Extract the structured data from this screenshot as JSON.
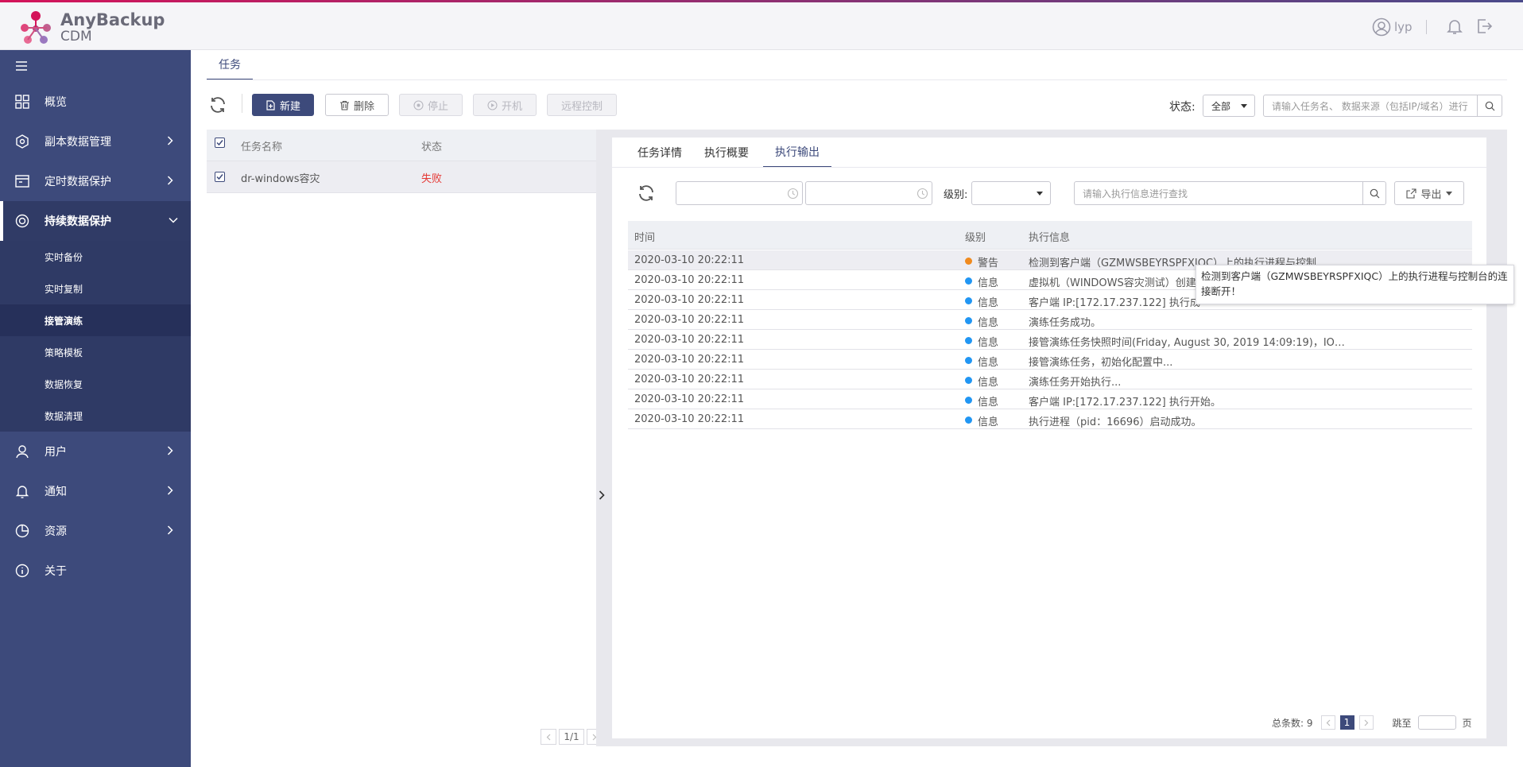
{
  "app": {
    "brand_name": "AnyBackup",
    "brand_sub": "CDM",
    "username": "lyp"
  },
  "colors": {
    "sidebar": "#3d4a7b",
    "accent": "#3d4a7b",
    "warning": "#f08a1e",
    "info": "#2196f3",
    "danger": "#e53935"
  },
  "sidebar": {
    "items": [
      {
        "label": "概览",
        "icon": "dashboard-icon"
      },
      {
        "label": "副本数据管理",
        "icon": "copy-data-icon"
      },
      {
        "label": "定时数据保护",
        "icon": "schedule-protect-icon"
      },
      {
        "label": "持续数据保护",
        "icon": "continuous-protect-icon"
      },
      {
        "label": "用户",
        "icon": "user-icon"
      },
      {
        "label": "通知",
        "icon": "bell-icon"
      },
      {
        "label": "资源",
        "icon": "pie-chart-icon"
      },
      {
        "label": "关于",
        "icon": "info-icon"
      }
    ],
    "subitems": [
      "实时备份",
      "实时复制",
      "接管演练",
      "策略模板",
      "数据恢复",
      "数据清理"
    ]
  },
  "page": {
    "tab": "任务"
  },
  "toolbar": {
    "new": "新建",
    "delete": "删除",
    "stop": "停止",
    "power_on": "开机",
    "remote": "远程控制",
    "status_label": "状态:",
    "status_value": "全部",
    "search_placeholder": "请输入任务名、 数据来源（包括IP/域名）进行"
  },
  "task_list": {
    "col_name": "任务名称",
    "col_status": "状态",
    "rows": [
      {
        "name": "dr-windows容灾",
        "status": "失败"
      }
    ],
    "pager": "1/1"
  },
  "detail": {
    "tabs": [
      "任务详情",
      "执行概要",
      "执行输出"
    ],
    "active_tab": 2,
    "level_label": "级别:",
    "search_placeholder": "请输入执行信息进行查找",
    "export_label": "导出",
    "col_time": "时间",
    "col_level": "级别",
    "col_info": "执行信息",
    "rows": [
      {
        "time": "2020-03-10 20:22:11",
        "level": "警告",
        "info": "检测到客户端（GZMWSBEYRSPFXIQC）上的执行进程与控制…",
        "type": "warning"
      },
      {
        "time": "2020-03-10 20:22:11",
        "level": "信息",
        "info": "虚拟机（WINDOWS容灾测试）创建",
        "type": "info"
      },
      {
        "time": "2020-03-10 20:22:11",
        "level": "信息",
        "info": "客户端 IP:[172.17.237.122] 执行成",
        "type": "info"
      },
      {
        "time": "2020-03-10 20:22:11",
        "level": "信息",
        "info": "演练任务成功。",
        "type": "info"
      },
      {
        "time": "2020-03-10 20:22:11",
        "level": "信息",
        "info": "接管演练任务快照时间(Friday, August 30, 2019 14:09:19)，IO…",
        "type": "info"
      },
      {
        "time": "2020-03-10 20:22:11",
        "level": "信息",
        "info": "接管演练任务，初始化配置中...",
        "type": "info"
      },
      {
        "time": "2020-03-10 20:22:11",
        "level": "信息",
        "info": "演练任务开始执行...",
        "type": "info"
      },
      {
        "time": "2020-03-10 20:22:11",
        "level": "信息",
        "info": "客户端 IP:[172.17.237.122] 执行开始。",
        "type": "info"
      },
      {
        "time": "2020-03-10 20:22:11",
        "level": "信息",
        "info": "执行进程（pid：16696）启动成功。",
        "type": "info"
      }
    ],
    "tooltip": "检测到客户端（GZMWSBEYRSPFXIQC）上的执行进程与控制台的连接断开！",
    "total_label": "总条数: 9",
    "current_page": "1",
    "goto_label": "跳至",
    "page_unit": "页"
  }
}
